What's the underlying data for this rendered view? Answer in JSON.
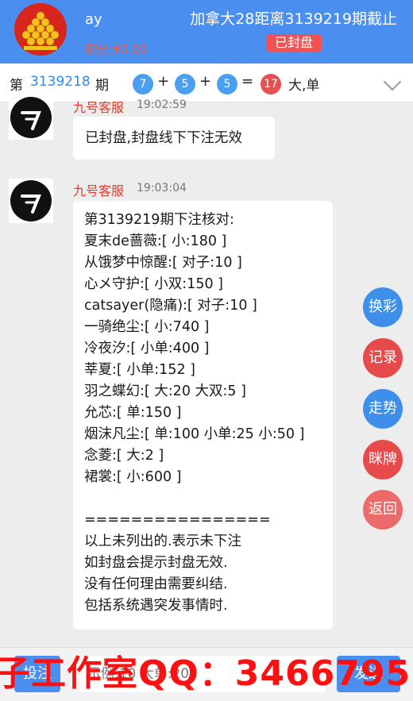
{
  "header": {
    "username": "ay",
    "points": "积分:¥0.00",
    "countdown": "加拿大28距离3139219期截止",
    "status": "已封盘"
  },
  "result_bar": {
    "prefix": "第",
    "issue": "3139218",
    "suffix": "期",
    "balls": [
      "7",
      "5",
      "5"
    ],
    "sum": "17",
    "plus": "+",
    "equals": "=",
    "result": "大,单"
  },
  "messages": [
    {
      "sender": "九号客服",
      "time": "19:02:59",
      "lines": [
        "已封盘,封盘线下下注无效"
      ]
    },
    {
      "sender": "九号客服",
      "time": "19:03:04",
      "lines": [
        "第3139219期下注核对:",
        "夏末de蔷薇:[ 小:180 ]",
        "从饿梦中惊醒:[ 对子:10 ]",
        "心メ守护:[ 小双:150 ]",
        "catsayer(隐痛):[ 对子:10 ]",
        "一骑绝尘:[ 小:740 ]",
        "冷夜汐:[ 小单:400 ]",
        "莘夏:[ 小单:152 ]",
        "羽之蝶幻:[ 大:20 大双:5 ]",
        "允芯:[ 单:150 ]",
        "烟沫凡尘:[ 单:100 小单:25 小:50 ]",
        "念菱:[ 大:2 ]",
        "裙裳:[ 小:600 ]",
        "",
        "================",
        "以上未列出的.表示未下注",
        "如封盘会提示封盘无效.",
        "没有任何理由需要纠结.",
        "包括系统遇突发事情时."
      ]
    }
  ],
  "side_buttons": [
    {
      "label": "换彩",
      "color": "#3d8fea"
    },
    {
      "label": "记录",
      "color": "#e64a4a"
    },
    {
      "label": "走势",
      "color": "#3d8fea"
    },
    {
      "label": "眯牌",
      "color": "#e64a4a"
    },
    {
      "label": "返回",
      "color": "#ec6a6a"
    }
  ],
  "bottom": {
    "bet_button": "投注",
    "input_placeholder": "示例:10 大单:20",
    "send_button": "发送"
  },
  "watermark": "子工作室QQ：3466795"
}
